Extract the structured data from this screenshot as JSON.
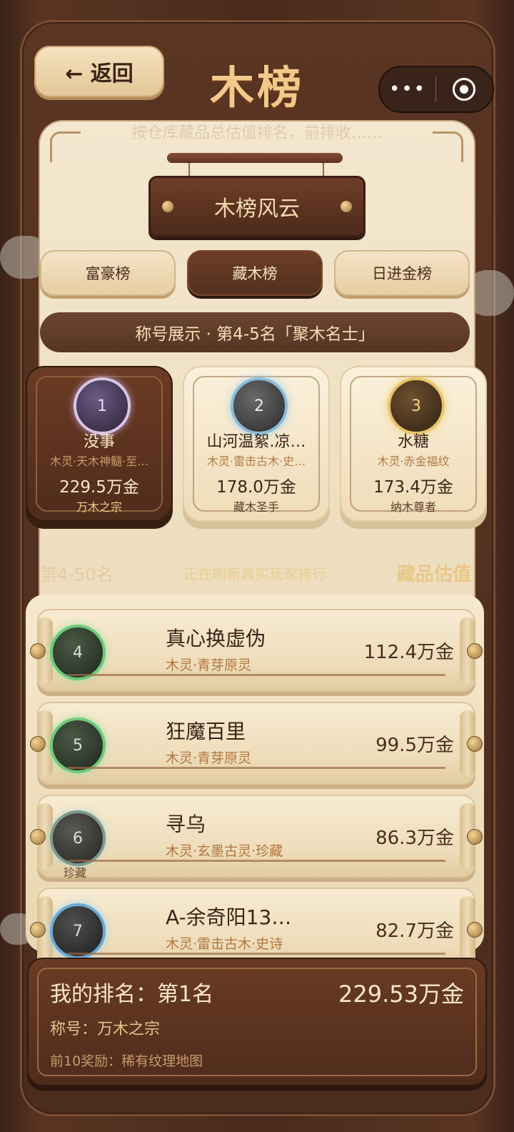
{
  "header": {
    "back_label": "← 返回",
    "title": "木榜",
    "capsule_more": "•••"
  },
  "panel": {
    "subtitle": "按仓库藏品总估值排名，前排收……",
    "plaque_title": "木榜风云"
  },
  "tabs": [
    {
      "label": "富豪榜",
      "active": false
    },
    {
      "label": "藏木榜",
      "active": true
    },
    {
      "label": "日进金榜",
      "active": false
    }
  ],
  "title_banner": "称号展示 · 第4-5名「聚木名士」",
  "podium": [
    {
      "rank": "1",
      "name": "没事",
      "sub": "木灵·天木神髓·至…",
      "value": "229.5万金",
      "title": "万木之宗"
    },
    {
      "rank": "2",
      "name": "山河温絮.凉…",
      "sub": "木灵·雷击古木·史…",
      "value": "178.0万金",
      "title": "藏木圣手"
    },
    {
      "rank": "3",
      "name": "水糖",
      "sub": "木灵·赤金福纹",
      "value": "173.4万金",
      "title": "纳木尊者"
    }
  ],
  "list_header": {
    "range": "第4-50名",
    "status": "正在刷新真实玩家排行",
    "metric": "藏品估值"
  },
  "rows": [
    {
      "rank": "4",
      "name": "真心换虚伪",
      "sub": "木灵·青芽原灵",
      "value": "112.4万金",
      "badge": ""
    },
    {
      "rank": "5",
      "name": "狂魔百里",
      "sub": "木灵·青芽原灵",
      "value": "99.5万金",
      "badge": ""
    },
    {
      "rank": "6",
      "name": "寻乌",
      "sub": "木灵·玄墨古灵·珍藏",
      "value": "86.3万金",
      "badge": "珍藏"
    },
    {
      "rank": "7",
      "name": "A-余奇阳13…",
      "sub": "木灵·雷击古木·史诗",
      "value": "82.7万金",
      "badge": ""
    }
  ],
  "my_rank": {
    "rank_text": "我的排名：第1名",
    "value": "229.53万金",
    "title_text": "称号：万木之宗",
    "reward_text": "前10奖励：稀有纹理地图"
  },
  "colors": {
    "wood_dark": "#4f2c1b",
    "parchment": "#f4e7cf",
    "gold_text": "#f2c98a"
  }
}
